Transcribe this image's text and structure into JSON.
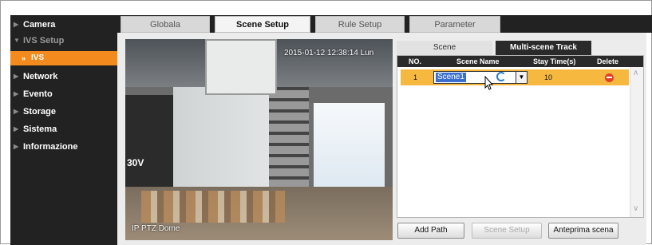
{
  "sidebar": {
    "items": [
      {
        "label": "Camera"
      },
      {
        "label": "IVS Setup"
      },
      {
        "label": "IVS"
      },
      {
        "label": "Network"
      },
      {
        "label": "Evento"
      },
      {
        "label": "Storage"
      },
      {
        "label": "Sistema"
      },
      {
        "label": "Informazione"
      }
    ]
  },
  "tabs": [
    {
      "label": "Globala"
    },
    {
      "label": "Scene Setup"
    },
    {
      "label": "Rule Setup"
    },
    {
      "label": "Parameter"
    }
  ],
  "video": {
    "timestamp": "2015-01-12 12:38:14 Lun",
    "camera_label": "IP PTZ Dome",
    "overlay_text": "30V"
  },
  "subtabs": [
    {
      "label": "Scene"
    },
    {
      "label": "Multi-scene Track"
    }
  ],
  "table": {
    "headers": {
      "no": "NO.",
      "scene_name": "Scene Name",
      "stay_time": "Stay Time(s)",
      "delete": "Delete"
    },
    "rows": [
      {
        "no": "1",
        "scene_name": "Scene1",
        "stay_time": "10"
      }
    ]
  },
  "buttons": {
    "add_path": "Add Path",
    "scene_setup": "Scene Setup",
    "preview": "Anteprima scena"
  },
  "colors": {
    "sidebar_bg": "#222222",
    "accent": "#f28a1d",
    "selected_row": "#f6b83e"
  }
}
